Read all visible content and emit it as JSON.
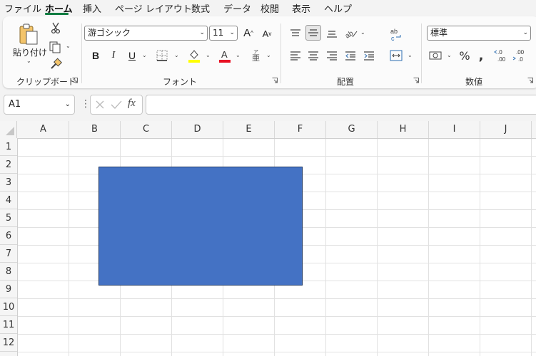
{
  "menu": {
    "tabs": [
      "ファイル",
      "ホーム",
      "挿入",
      "ページ レイアウト",
      "数式",
      "データ",
      "校閲",
      "表示",
      "ヘルプ"
    ],
    "active": "ホーム"
  },
  "ribbon": {
    "clipboard": {
      "label": "クリップボード",
      "paste_label": "貼り付け"
    },
    "font": {
      "label": "フォント",
      "font_name": "游ゴシック",
      "font_size": "11"
    },
    "alignment": {
      "label": "配置"
    },
    "number": {
      "label": "数値",
      "format": "標準"
    }
  },
  "formula_bar": {
    "name_box": "A1",
    "fx": "fx",
    "formula": ""
  },
  "sheet": {
    "columns": [
      "A",
      "B",
      "C",
      "D",
      "E",
      "F",
      "G",
      "H",
      "I",
      "J"
    ],
    "rows": [
      "1",
      "2",
      "3",
      "4",
      "5",
      "6",
      "7",
      "8",
      "9",
      "10",
      "11",
      "12"
    ]
  },
  "shape": {
    "type": "rectangle",
    "fill": "#4472c4",
    "stroke": "#1f3864"
  },
  "colors": {
    "accent": "#107c41",
    "highlight": "#ffff00",
    "font_color": "#e81123"
  }
}
